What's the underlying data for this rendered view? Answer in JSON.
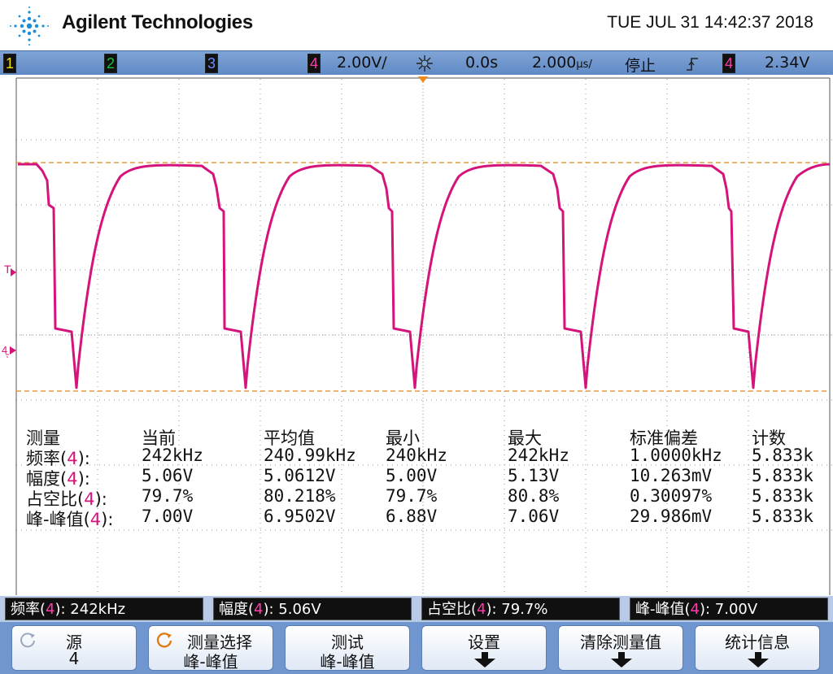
{
  "header": {
    "brand": "Agilent Technologies",
    "datetime": "TUE JUL 31 14:42:37 2018"
  },
  "statusbar": {
    "ch1": "1",
    "ch2": "2",
    "ch3": "3",
    "ch4": "4",
    "scale": "2.00V/",
    "offset": "0.0s",
    "timebase": "2.000",
    "timebase_unit": "μs/",
    "run_state": "停止",
    "trigger_channel": "4",
    "trigger_level": "2.34V",
    "colors": {
      "ch1": "#f2e600",
      "ch2": "#17c23a",
      "ch3": "#3a5ee6",
      "ch4": "#e01a8c"
    }
  },
  "markers": {
    "trigger_marker": "T",
    "ch4_ground": "4"
  },
  "waveform": {
    "color": "#d4147a",
    "cursor_color": "#e59a3c"
  },
  "measurements": {
    "headers": [
      "测量",
      "当前",
      "平均值",
      "最小",
      "最大",
      "标准偏差",
      "计数"
    ],
    "rows": [
      {
        "name": "频率",
        "ch": "4",
        "values": [
          "242kHz",
          "240.99kHz",
          "240kHz",
          "242kHz",
          "1.0000kHz",
          "5.833k"
        ]
      },
      {
        "name": "幅度",
        "ch": "4",
        "values": [
          "5.06V",
          "5.0612V",
          "5.00V",
          "5.13V",
          "10.263mV",
          "5.833k"
        ]
      },
      {
        "name": "占空比",
        "ch": "4",
        "values": [
          "79.7%",
          "80.218%",
          "79.7%",
          "80.8%",
          "0.30097%",
          "5.833k"
        ]
      },
      {
        "name": "峰-峰值",
        "ch": "4",
        "values": [
          "7.00V",
          "6.9502V",
          "6.88V",
          "7.06V",
          "29.986mV",
          "5.833k"
        ]
      }
    ]
  },
  "readouts": [
    {
      "name": "频率",
      "ch": "4",
      "value": "242kHz"
    },
    {
      "name": "幅度",
      "ch": "4",
      "value": "5.06V"
    },
    {
      "name": "占空比",
      "ch": "4",
      "value": "79.7%"
    },
    {
      "name": "峰-峰值",
      "ch": "4",
      "value": "7.00V"
    }
  ],
  "softkeys": [
    {
      "line1": "源",
      "line2": "4"
    },
    {
      "line1": "测量选择",
      "line2": "峰-峰值"
    },
    {
      "line1": "测试",
      "line2": "峰-峰值"
    },
    {
      "line1": "设置",
      "line2": ""
    },
    {
      "line1": "清除测量值",
      "line2": ""
    },
    {
      "line1": "统计信息",
      "line2": ""
    }
  ]
}
